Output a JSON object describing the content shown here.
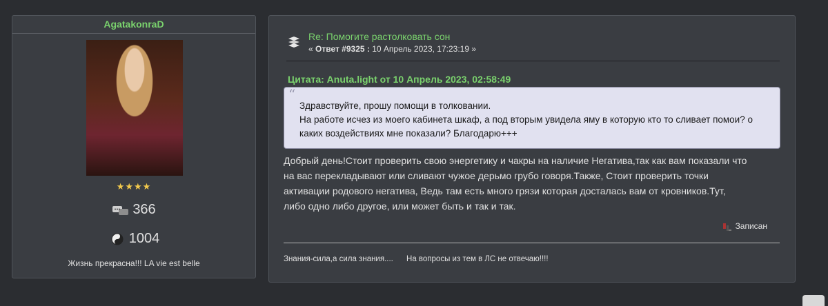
{
  "user": {
    "name": "AgatakonraD",
    "stars": "★★★★",
    "posts_count": "366",
    "karma_count": "1004",
    "signature": "Жизнь прекрасна!!! LA vie est belle",
    "posts_icon": "speech-bubbles-icon",
    "karma_icon": "yin-yang-icon"
  },
  "post": {
    "title": "Re: Помогите растолковать сон",
    "meta_prefix": "« ",
    "reply_label": "Ответ #9325 :",
    "date": " 10 Апрель 2023, 17:23:19 »",
    "quote_header": "Цитата: Anuta.light от 10 Апрель 2023, 02:58:49",
    "quote_mark": "“",
    "quote_lines": [
      "Здравствуйте, прошу помощи в толковании.",
      "На работе исчез из моего кабинета шкаф,  а под вторым увидела яму в которую кто то сливает помои? о",
      "каких воздействиях мне показали? Благодарю+++"
    ],
    "body_lines": [
      "Добрый день!Стоит проверить свою энергетику и чакры на наличие Негатива,так как вам показали что",
      "на вас перекладывают или сливают чужое дерьмо грубо говоря.Также, Стоит проверить точки",
      "активации родового негатива, Ведь там есть много грязи которая досталась вам от кровников.Тут,",
      "либо одно либо другое, или может быть и так и так."
    ],
    "record_label": "Записан",
    "signature": "Знания-сила,а сила знания....      На вопросы из тем в ЛС не отвечаю!!!!"
  }
}
